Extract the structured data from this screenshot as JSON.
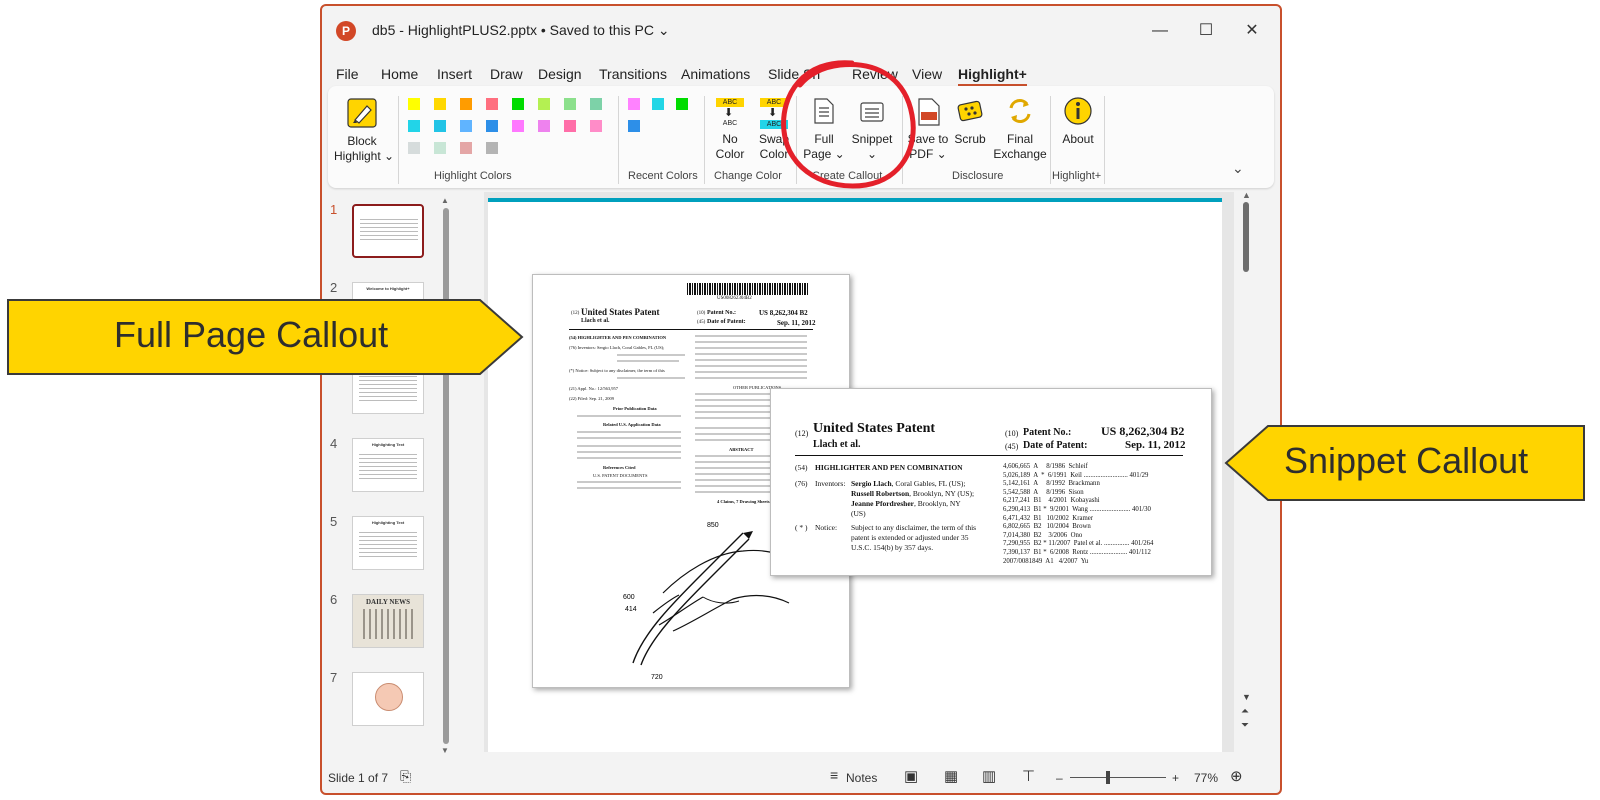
{
  "window": {
    "title": "db5 - HighlightPLUS2.pptx • Saved to this PC ⌄",
    "app_icon": "powerpoint-icon",
    "controls": {
      "minimize": "—",
      "maximize": "☐",
      "close": "✕"
    }
  },
  "menu": {
    "items": [
      "File",
      "Home",
      "Insert",
      "Draw",
      "Design",
      "Transitions",
      "Animations",
      "Slide Sh",
      "Review",
      "View"
    ],
    "active": "Highlight+"
  },
  "ribbon": {
    "block_highlight": {
      "line1": "Block",
      "line2": "Highlight ⌄",
      "icon": "highlighter-icon"
    },
    "highlight_colors_label": "Highlight Colors",
    "recent_colors_label": "Recent Colors",
    "change_color_label": "Change Color",
    "no_color": {
      "line1": "No",
      "line2": "Color",
      "abc": "ABC"
    },
    "swap_color": {
      "line1": "Swap",
      "line2": "Color",
      "abc": "ABC"
    },
    "create_callout_label": "Create Callout",
    "full_page": {
      "line1": "Full",
      "line2": "Page ⌄",
      "icon": "full-page-icon"
    },
    "snippet": {
      "line1": "Snippet",
      "line2": "⌄",
      "icon": "snippet-icon"
    },
    "disclosure_label": "Disclosure",
    "save_to_pdf": {
      "line1": "Save to",
      "line2": "PDF ⌄",
      "icon": "pdf-icon"
    },
    "scrub": {
      "line1": "Scrub",
      "icon": "sponge-icon"
    },
    "final_exchange": {
      "line1": "Final",
      "line2": "Exchange",
      "icon": "exchange-icon"
    },
    "highlight_plus_label": "Highlight+",
    "about": {
      "line1": "About",
      "icon": "info-icon"
    },
    "collapse": "⌄",
    "colors": {
      "row1": [
        "#ffff00",
        "#ffd800",
        "#ff9c00",
        "#ff6f7f",
        "#00dc00",
        "#b4f052",
        "#8ce08c",
        "#7dd2a8"
      ],
      "row2": [
        "#22d4e8",
        "#22c4e6",
        "#60b4ff",
        "#2d8fe8",
        "#ff78ff",
        "#ee82ee",
        "#ff6ea8",
        "#ff8cc8"
      ],
      "row3": [
        "#d6dcdc",
        "#c8e6d6",
        "#e4a6a6",
        "#b4b4b4"
      ],
      "recent_row1": [
        "#ff82ff",
        "#22d6e6",
        "#00dc00"
      ],
      "recent_row2": [
        "#2d8fe8"
      ]
    }
  },
  "thumbnails": [
    {
      "num": "1",
      "title": ""
    },
    {
      "num": "2",
      "title": "Welcome to Highlight+"
    },
    {
      "num": "3",
      "title": ""
    },
    {
      "num": "4",
      "title": "Highlighting Text"
    },
    {
      "num": "5",
      "title": "Highlighting Text"
    },
    {
      "num": "6",
      "title": "DAILY NEWS"
    },
    {
      "num": "7",
      "title": ""
    }
  ],
  "full_patent": {
    "barcode_number": "US008262304B2",
    "country_code": "(12)",
    "heading": "United States Patent",
    "inventor_short": "Llach et al.",
    "patent_no_code": "(10)",
    "patent_no_label": "Patent No.:",
    "patent_no": "US 8,262,304 B2",
    "date_code": "(45)",
    "date_label": "Date of Patent:",
    "date": "Sep. 11, 2012",
    "title_line": "(54) HIGHLIGHTER AND PEN COMBINATION",
    "inventors_line": "(76) Inventors: Sergio Llach, Coral Gables, FL (US);",
    "notice_line": "(*) Notice: Subject to any disclaimer, the term of this",
    "appl_line": "(21) Appl. No.: 12/563,957",
    "filed_line": "(22) Filed: Sep. 21, 2009",
    "prior_pub": "Prior Publication Data",
    "related": "Related U.S. Application Data",
    "refs_cited": "References Cited",
    "us_docs": "U.S. PATENT DOCUMENTS",
    "other_pub": "OTHER PUBLICATIONS",
    "abstract": "ABSTRACT",
    "claims": "4 Claims, 7 Drawing Sheets",
    "fig_labels": [
      "850",
      "600",
      "414",
      "720"
    ]
  },
  "snippet_patent": {
    "country_code": "(12)",
    "heading": "United States Patent",
    "inventor_short": "Llach et al.",
    "patent_no_code": "(10)",
    "patent_no_label": "Patent No.:",
    "patent_no": "US 8,262,304 B2",
    "date_code": "(45)",
    "date_label": "Date of Patent:",
    "date": "Sep. 11, 2012",
    "title_code": "(54)",
    "title": "HIGHLIGHTER AND PEN COMBINATION",
    "inventors_code": "(76)",
    "inventors_label": "Inventors:",
    "inventors": [
      {
        "name": "Sergio Llach",
        "rest": ", Coral Gables, FL (US);"
      },
      {
        "name": "Russell Robertson",
        "rest": ", Brooklyn, NY (US);"
      },
      {
        "name": "Jeanne Pfordresher",
        "rest": ", Brooklyn, NY"
      },
      {
        "name": "",
        "rest": "(US)"
      }
    ],
    "notice_code": "( * )",
    "notice_label": "Notice:",
    "notice_lines": [
      "Subject to any disclaimer, the term of this",
      "patent is extended or adjusted under 35",
      "U.S.C. 154(b) by 357 days."
    ],
    "refs": [
      "4,606,665  A     8/1986  Schleif",
      "5,026,189  A  *  6/1991  Keil .......................... 401/29",
      "5,142,161  A     8/1992  Brackmann",
      "5,542,588  A     8/1996  Sison",
      "6,217,241  B1    4/2001  Kobayashi",
      "6,290,413  B1 *  9/2001  Wang ........................ 401/30",
      "6,471,432  B1   10/2002  Kramer",
      "6,802,665  B2   10/2004  Brown",
      "7,014,380  B2    3/2006  Ono",
      "7,290,955  B2 * 11/2007  Patel et al. ............... 401/264",
      "7,390,137  B1 *  6/2008  Rentz ...................... 401/112",
      "2007/0081849  A1   4/2007  Yu"
    ]
  },
  "callouts": {
    "full_page": "Full Page Callout",
    "snippet": "Snippet Callout",
    "fill_color": "#ffd400"
  },
  "status": {
    "slide_info": "Slide 1 of 7",
    "notes": "Notes",
    "zoom": "77%",
    "zoom_minus": "–",
    "zoom_plus": "+"
  }
}
